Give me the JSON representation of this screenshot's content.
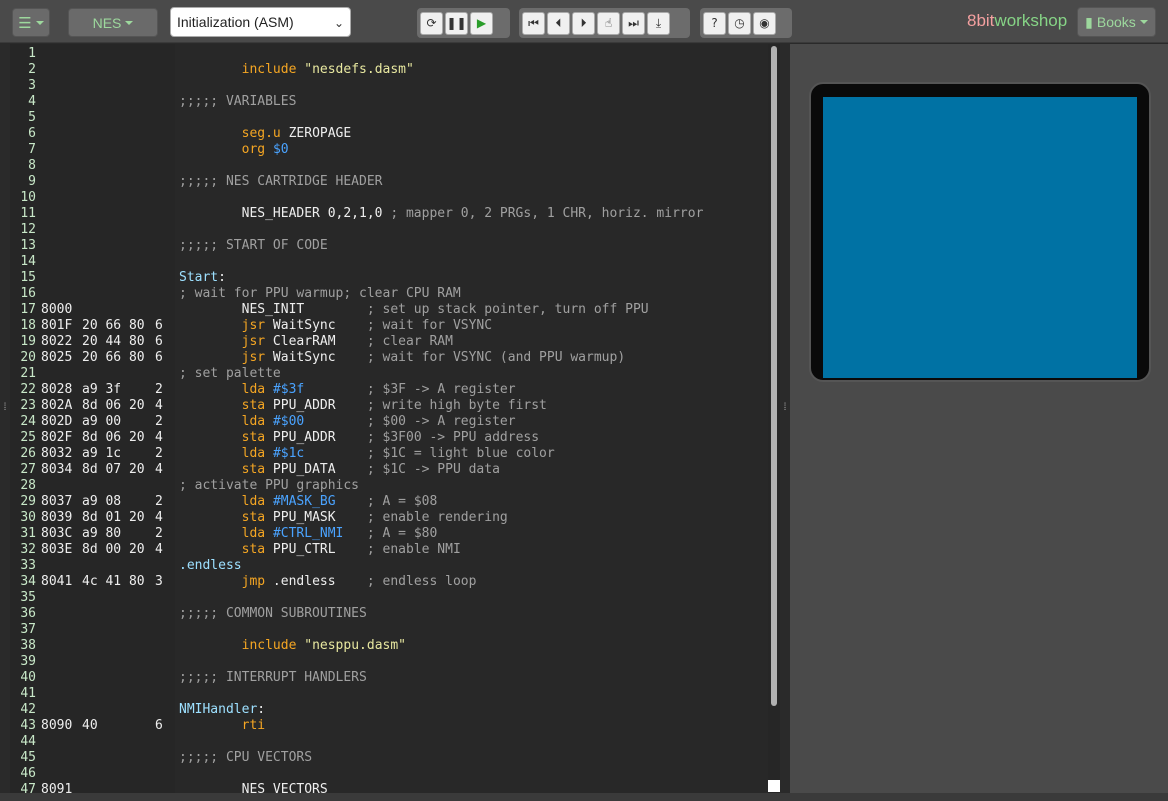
{
  "toolbar": {
    "menu_icon": "hamburger-icon",
    "platform_label": "NES",
    "file_selected": "Initialization (ASM)",
    "controls_group1": [
      "reset-icon",
      "pause-icon",
      "play-icon"
    ],
    "controls_group2": [
      "rewind-icon",
      "step-back-icon",
      "step-forward-icon",
      "step-into-icon",
      "fast-forward-icon",
      "download-icon"
    ],
    "controls_group3": [
      "help-icon",
      "clock-icon",
      "record-icon"
    ],
    "brand_8bit": "8bit",
    "brand_work": "workshop",
    "books_label": "Books"
  },
  "colors": {
    "screen": "#0072a4",
    "accent": "#9dd89d"
  },
  "gutter": [
    {
      "ln": "1",
      "addr": "",
      "bytes": "",
      "cyc": ""
    },
    {
      "ln": "2",
      "addr": "",
      "bytes": "",
      "cyc": ""
    },
    {
      "ln": "3",
      "addr": "",
      "bytes": "",
      "cyc": ""
    },
    {
      "ln": "4",
      "addr": "",
      "bytes": "",
      "cyc": ""
    },
    {
      "ln": "5",
      "addr": "",
      "bytes": "",
      "cyc": ""
    },
    {
      "ln": "6",
      "addr": "",
      "bytes": "",
      "cyc": ""
    },
    {
      "ln": "7",
      "addr": "",
      "bytes": "",
      "cyc": ""
    },
    {
      "ln": "8",
      "addr": "",
      "bytes": "",
      "cyc": ""
    },
    {
      "ln": "9",
      "addr": "",
      "bytes": "",
      "cyc": ""
    },
    {
      "ln": "10",
      "addr": "",
      "bytes": "",
      "cyc": ""
    },
    {
      "ln": "11",
      "addr": "",
      "bytes": "",
      "cyc": ""
    },
    {
      "ln": "12",
      "addr": "",
      "bytes": "",
      "cyc": ""
    },
    {
      "ln": "13",
      "addr": "",
      "bytes": "",
      "cyc": ""
    },
    {
      "ln": "14",
      "addr": "",
      "bytes": "",
      "cyc": ""
    },
    {
      "ln": "15",
      "addr": "",
      "bytes": "",
      "cyc": ""
    },
    {
      "ln": "16",
      "addr": "",
      "bytes": "",
      "cyc": ""
    },
    {
      "ln": "17",
      "addr": "8000",
      "bytes": "",
      "cyc": ""
    },
    {
      "ln": "18",
      "addr": "801F",
      "bytes": "20 66 80",
      "cyc": "6"
    },
    {
      "ln": "19",
      "addr": "8022",
      "bytes": "20 44 80",
      "cyc": "6"
    },
    {
      "ln": "20",
      "addr": "8025",
      "bytes": "20 66 80",
      "cyc": "6"
    },
    {
      "ln": "21",
      "addr": "",
      "bytes": "",
      "cyc": ""
    },
    {
      "ln": "22",
      "addr": "8028",
      "bytes": "a9 3f",
      "cyc": "2"
    },
    {
      "ln": "23",
      "addr": "802A",
      "bytes": "8d 06 20",
      "cyc": "4"
    },
    {
      "ln": "24",
      "addr": "802D",
      "bytes": "a9 00",
      "cyc": "2"
    },
    {
      "ln": "25",
      "addr": "802F",
      "bytes": "8d 06 20",
      "cyc": "4"
    },
    {
      "ln": "26",
      "addr": "8032",
      "bytes": "a9 1c",
      "cyc": "2"
    },
    {
      "ln": "27",
      "addr": "8034",
      "bytes": "8d 07 20",
      "cyc": "4"
    },
    {
      "ln": "28",
      "addr": "",
      "bytes": "",
      "cyc": ""
    },
    {
      "ln": "29",
      "addr": "8037",
      "bytes": "a9 08",
      "cyc": "2"
    },
    {
      "ln": "30",
      "addr": "8039",
      "bytes": "8d 01 20",
      "cyc": "4"
    },
    {
      "ln": "31",
      "addr": "803C",
      "bytes": "a9 80",
      "cyc": "2"
    },
    {
      "ln": "32",
      "addr": "803E",
      "bytes": "8d 00 20",
      "cyc": "4"
    },
    {
      "ln": "33",
      "addr": "",
      "bytes": "",
      "cyc": ""
    },
    {
      "ln": "34",
      "addr": "8041",
      "bytes": "4c 41 80",
      "cyc": "3"
    },
    {
      "ln": "35",
      "addr": "",
      "bytes": "",
      "cyc": ""
    },
    {
      "ln": "36",
      "addr": "",
      "bytes": "",
      "cyc": ""
    },
    {
      "ln": "37",
      "addr": "",
      "bytes": "",
      "cyc": ""
    },
    {
      "ln": "38",
      "addr": "",
      "bytes": "",
      "cyc": ""
    },
    {
      "ln": "39",
      "addr": "",
      "bytes": "",
      "cyc": ""
    },
    {
      "ln": "40",
      "addr": "",
      "bytes": "",
      "cyc": ""
    },
    {
      "ln": "41",
      "addr": "",
      "bytes": "",
      "cyc": ""
    },
    {
      "ln": "42",
      "addr": "",
      "bytes": "",
      "cyc": ""
    },
    {
      "ln": "43",
      "addr": "8090",
      "bytes": "40",
      "cyc": "6"
    },
    {
      "ln": "44",
      "addr": "",
      "bytes": "",
      "cyc": ""
    },
    {
      "ln": "45",
      "addr": "",
      "bytes": "",
      "cyc": ""
    },
    {
      "ln": "46",
      "addr": "",
      "bytes": "",
      "cyc": ""
    },
    {
      "ln": "47",
      "addr": "8091",
      "bytes": "",
      "cyc": ""
    }
  ],
  "code": [
    [],
    [
      [
        "",
        "        "
      ],
      [
        "kw",
        "include"
      ],
      [
        "",
        " "
      ],
      [
        "str",
        "\"nesdefs.dasm\""
      ]
    ],
    [],
    [
      [
        "cm",
        ";;;;; VARIABLES"
      ]
    ],
    [],
    [
      [
        "",
        "        "
      ],
      [
        "kw",
        "seg.u"
      ],
      [
        "",
        " ZEROPAGE"
      ]
    ],
    [
      [
        "",
        "        "
      ],
      [
        "kw",
        "org"
      ],
      [
        "",
        " "
      ],
      [
        "num",
        "$0"
      ]
    ],
    [],
    [
      [
        "cm",
        ";;;;; NES CARTRIDGE HEADER"
      ]
    ],
    [],
    [
      [
        "",
        "        NES_HEADER 0,2,1,0 "
      ],
      [
        "cm",
        "; mapper 0, 2 PRGs, 1 CHR, horiz. mirror"
      ]
    ],
    [],
    [
      [
        "cm",
        ";;;;; START OF CODE"
      ]
    ],
    [],
    [
      [
        "lbl",
        "Start"
      ],
      [
        "",
        ":"
      ]
    ],
    [
      [
        "cm",
        "; wait for PPU warmup; clear CPU RAM"
      ]
    ],
    [
      [
        "",
        "        NES_INIT        "
      ],
      [
        "cm",
        "; set up stack pointer, turn off PPU"
      ]
    ],
    [
      [
        "",
        "        "
      ],
      [
        "kw",
        "jsr"
      ],
      [
        "",
        " WaitSync    "
      ],
      [
        "cm",
        "; wait for VSYNC"
      ]
    ],
    [
      [
        "",
        "        "
      ],
      [
        "kw",
        "jsr"
      ],
      [
        "",
        " ClearRAM    "
      ],
      [
        "cm",
        "; clear RAM"
      ]
    ],
    [
      [
        "",
        "        "
      ],
      [
        "kw",
        "jsr"
      ],
      [
        "",
        " WaitSync    "
      ],
      [
        "cm",
        "; wait for VSYNC (and PPU warmup)"
      ]
    ],
    [
      [
        "cm",
        "; set palette"
      ]
    ],
    [
      [
        "",
        "        "
      ],
      [
        "kw",
        "lda"
      ],
      [
        "",
        " "
      ],
      [
        "num",
        "#$3f"
      ],
      [
        "",
        "        "
      ],
      [
        "cm",
        "; $3F -> A register"
      ]
    ],
    [
      [
        "",
        "        "
      ],
      [
        "kw",
        "sta"
      ],
      [
        "",
        " PPU_ADDR    "
      ],
      [
        "cm",
        "; write high byte first"
      ]
    ],
    [
      [
        "",
        "        "
      ],
      [
        "kw",
        "lda"
      ],
      [
        "",
        " "
      ],
      [
        "num",
        "#$00"
      ],
      [
        "",
        "        "
      ],
      [
        "cm",
        "; $00 -> A register"
      ]
    ],
    [
      [
        "",
        "        "
      ],
      [
        "kw",
        "sta"
      ],
      [
        "",
        " PPU_ADDR    "
      ],
      [
        "cm",
        "; $3F00 -> PPU address"
      ]
    ],
    [
      [
        "",
        "        "
      ],
      [
        "kw",
        "lda"
      ],
      [
        "",
        " "
      ],
      [
        "num",
        "#$1c"
      ],
      [
        "",
        "        "
      ],
      [
        "cm",
        "; $1C = light blue color"
      ]
    ],
    [
      [
        "",
        "        "
      ],
      [
        "kw",
        "sta"
      ],
      [
        "",
        " PPU_DATA    "
      ],
      [
        "cm",
        "; $1C -> PPU data"
      ]
    ],
    [
      [
        "cm",
        "; activate PPU graphics"
      ]
    ],
    [
      [
        "",
        "        "
      ],
      [
        "kw",
        "lda"
      ],
      [
        "",
        " "
      ],
      [
        "num",
        "#MASK_BG"
      ],
      [
        "",
        "    "
      ],
      [
        "cm",
        "; A = $08"
      ]
    ],
    [
      [
        "",
        "        "
      ],
      [
        "kw",
        "sta"
      ],
      [
        "",
        " PPU_MASK    "
      ],
      [
        "cm",
        "; enable rendering"
      ]
    ],
    [
      [
        "",
        "        "
      ],
      [
        "kw",
        "lda"
      ],
      [
        "",
        " "
      ],
      [
        "num",
        "#CTRL_NMI"
      ],
      [
        "",
        "   "
      ],
      [
        "cm",
        "; A = $80"
      ]
    ],
    [
      [
        "",
        "        "
      ],
      [
        "kw",
        "sta"
      ],
      [
        "",
        " PPU_CTRL    "
      ],
      [
        "cm",
        "; enable NMI"
      ]
    ],
    [
      [
        "lbl",
        ".endless"
      ]
    ],
    [
      [
        "",
        "        "
      ],
      [
        "kw",
        "jmp"
      ],
      [
        "",
        " .endless    "
      ],
      [
        "cm",
        "; endless loop"
      ]
    ],
    [],
    [
      [
        "cm",
        ";;;;; COMMON SUBROUTINES"
      ]
    ],
    [],
    [
      [
        "",
        "        "
      ],
      [
        "kw",
        "include"
      ],
      [
        "",
        " "
      ],
      [
        "str",
        "\"nesppu.dasm\""
      ]
    ],
    [],
    [
      [
        "cm",
        ";;;;; INTERRUPT HANDLERS"
      ]
    ],
    [],
    [
      [
        "lbl",
        "NMIHandler"
      ],
      [
        "",
        ":"
      ]
    ],
    [
      [
        "",
        "        "
      ],
      [
        "kw",
        "rti"
      ]
    ],
    [],
    [
      [
        "cm",
        ";;;;; CPU VECTORS"
      ]
    ],
    [],
    [
      [
        "",
        "        NES_VECTORS"
      ]
    ]
  ]
}
